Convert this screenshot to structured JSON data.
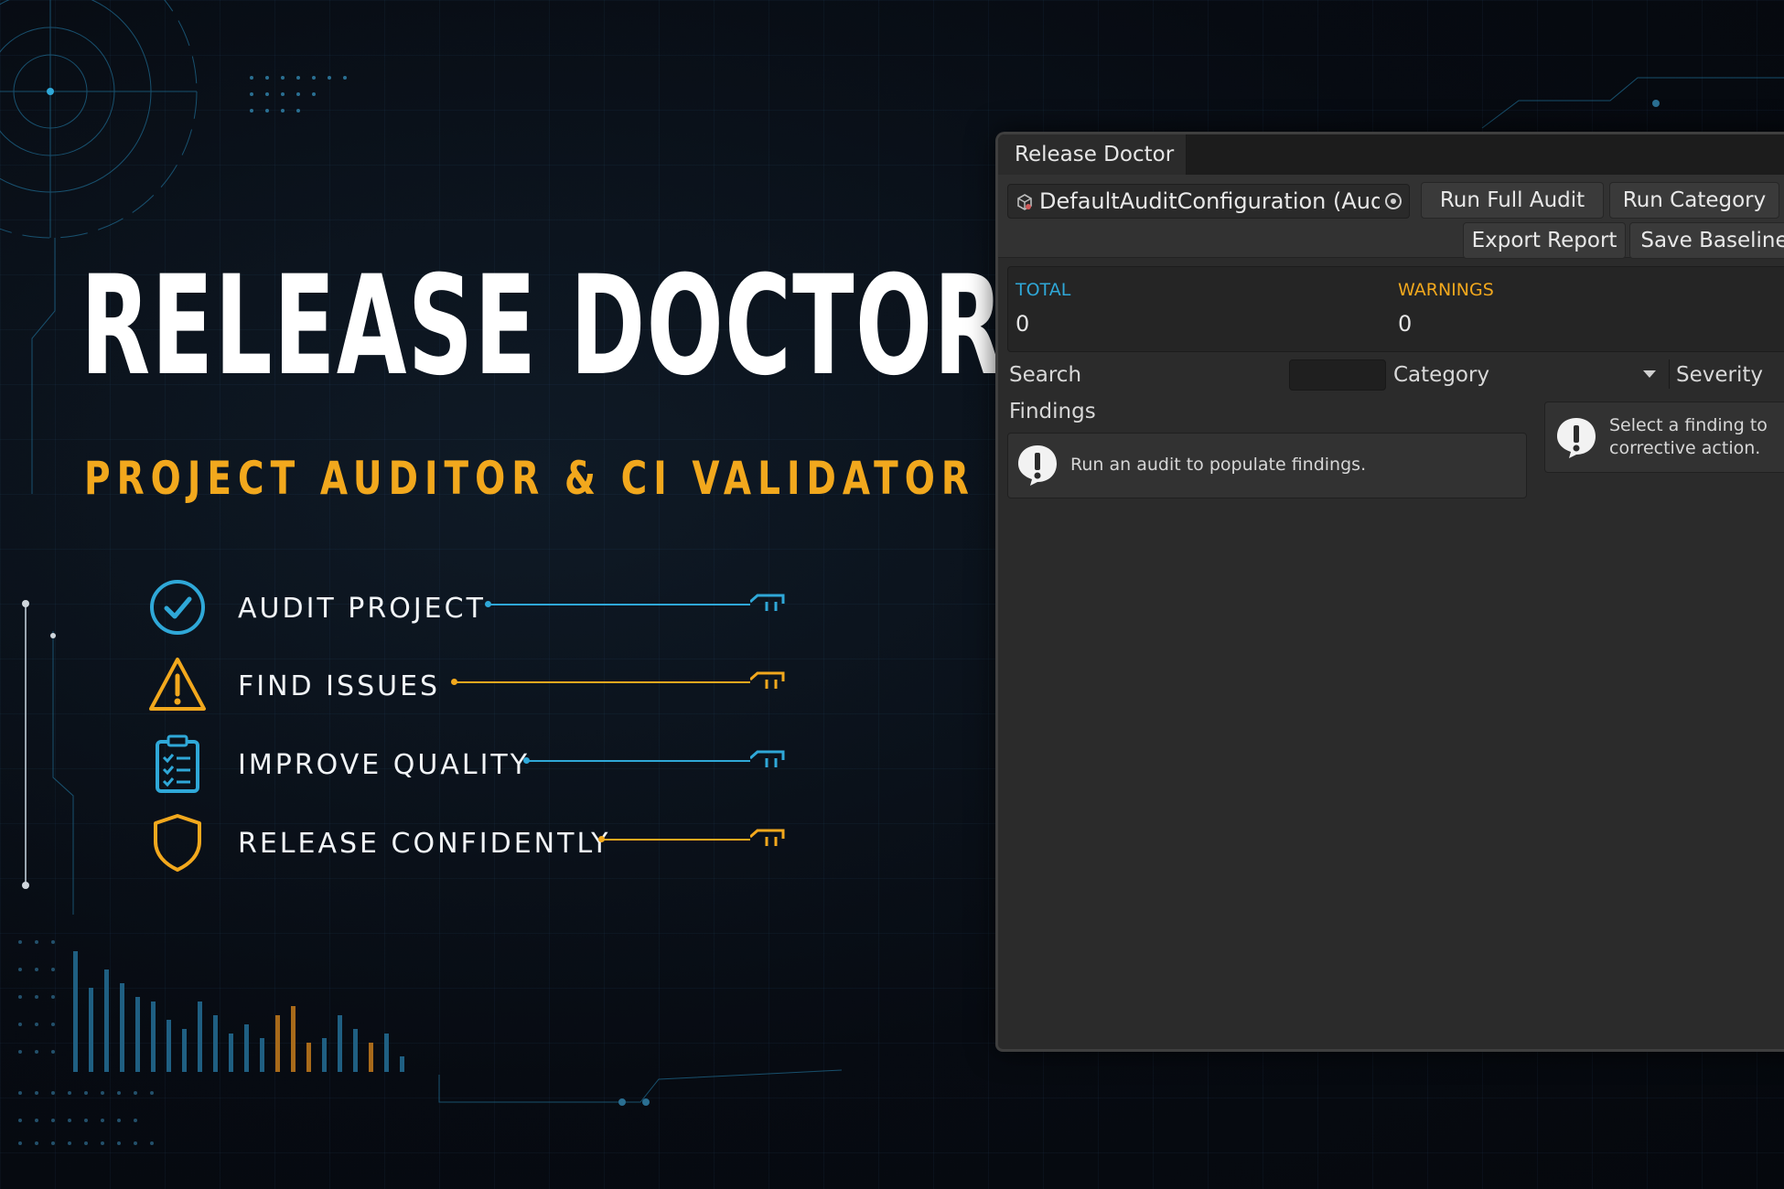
{
  "hero": {
    "title": "RELEASE DOCTOR",
    "subtitle": "PROJECT AUDITOR & CI VALIDATOR"
  },
  "features": [
    {
      "label": "AUDIT PROJECT",
      "icon": "check-circle-icon",
      "color": "#2fa8d8"
    },
    {
      "label": "FIND ISSUES",
      "icon": "warning-triangle-icon",
      "color": "#f2a81d"
    },
    {
      "label": "IMPROVE QUALITY",
      "icon": "clipboard-checklist-icon",
      "color": "#2fa8d8"
    },
    {
      "label": "RELEASE CONFIDENTLY",
      "icon": "shield-icon",
      "color": "#f2a81d"
    }
  ],
  "window": {
    "tab_title": "Release Doctor",
    "config_field": "DefaultAuditConfiguration (Audi",
    "buttons": {
      "run_full_audit": "Run Full Audit",
      "run_category": "Run Category",
      "export_report": "Export Report",
      "save_baseline": "Save Baseline"
    },
    "stats": {
      "total_label": "TOTAL",
      "total_value": "0",
      "warnings_label": "WARNINGS",
      "warnings_value": "0"
    },
    "filters": {
      "search_label": "Search",
      "category_label": "Category",
      "severity_label": "Severity"
    },
    "findings": {
      "header": "Findings",
      "empty_message": "Run an audit to populate findings."
    },
    "details": {
      "message_line1": "Select a finding to",
      "message_line2": "corrective action."
    }
  },
  "colors": {
    "accent_blue": "#2fa8d8",
    "accent_orange": "#f2a81d",
    "panel_bg": "#2b2b2b"
  }
}
